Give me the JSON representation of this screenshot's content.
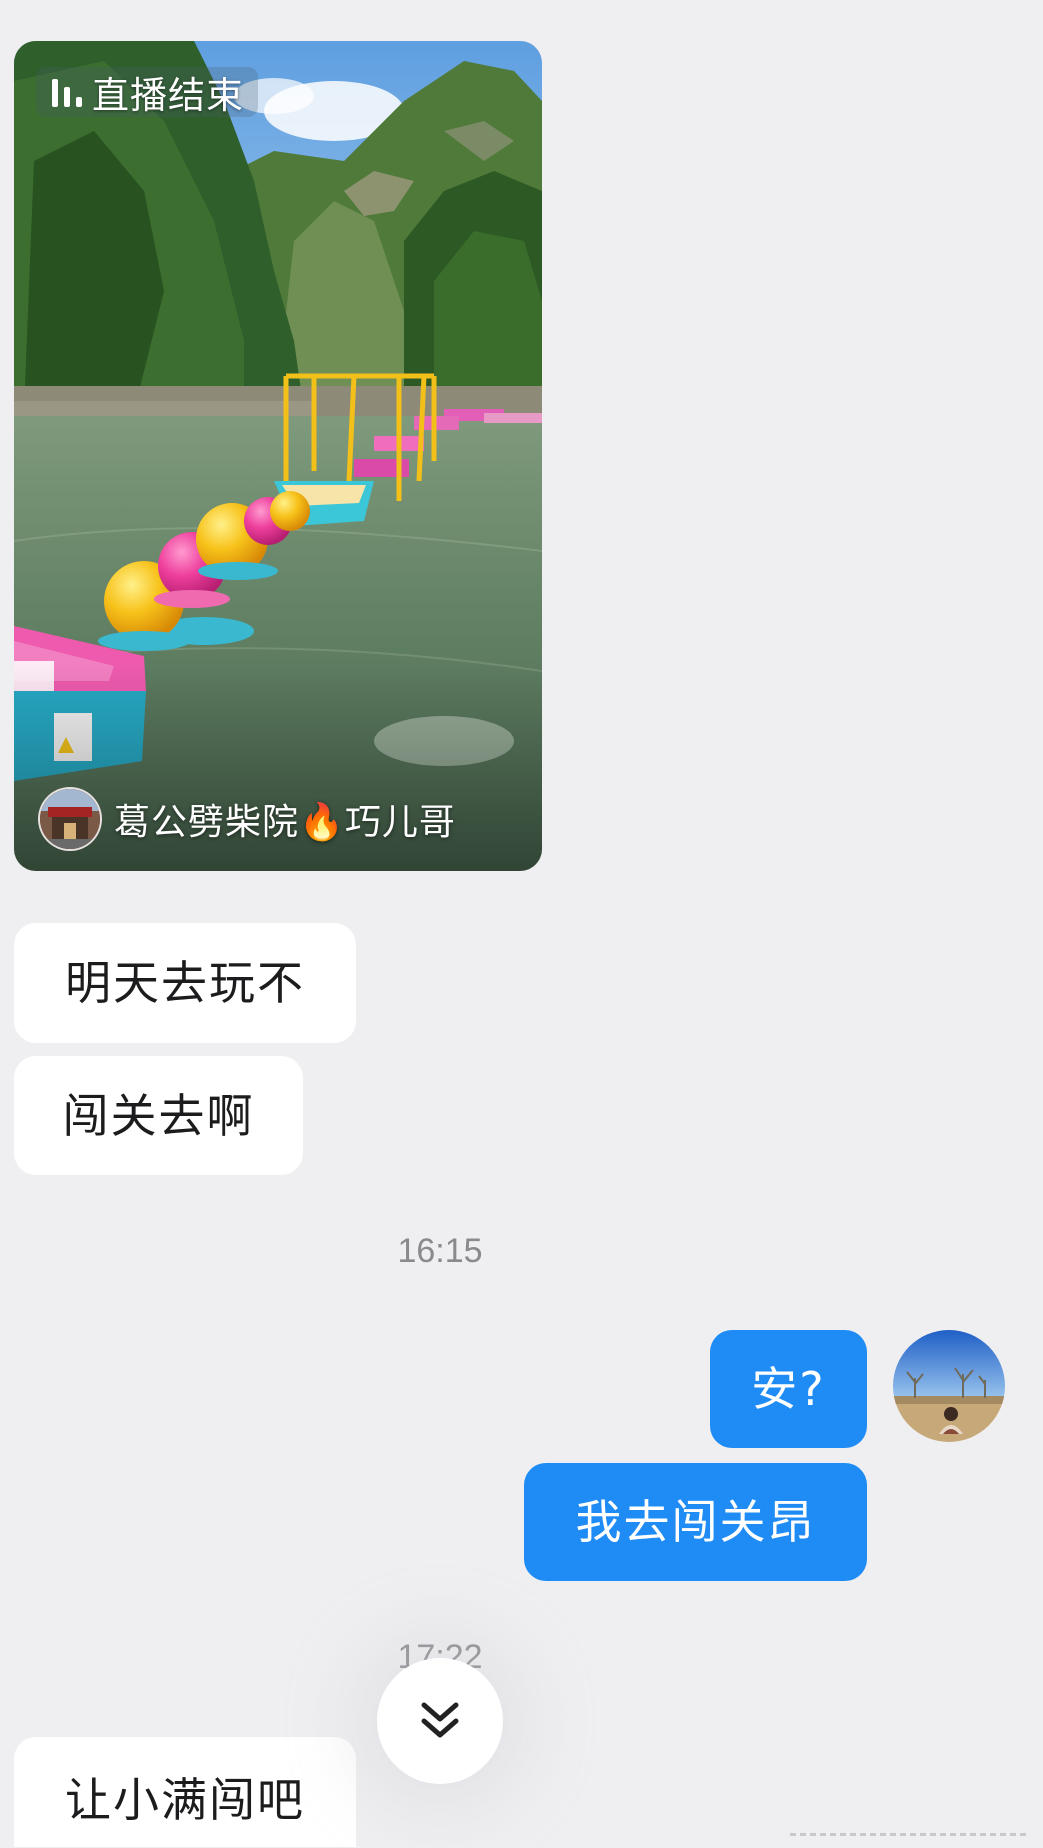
{
  "live_card": {
    "status": "直播结束",
    "host_name": "葛公劈柴院🔥巧儿哥"
  },
  "messages": {
    "m1": "明天去玩不",
    "m2": "闯关去啊",
    "t1": "16:15",
    "m3": "安?",
    "m4": "我去闯关昂",
    "t2": "17:22",
    "m5": "让小满闯吧"
  },
  "colors": {
    "background": "#efeff1",
    "incoming_bubble": "#ffffff",
    "outgoing_bubble": "#1f8cf6"
  },
  "icons": {
    "live_status": "audio-bars-icon",
    "scroll": "chevron-double-down-icon"
  }
}
